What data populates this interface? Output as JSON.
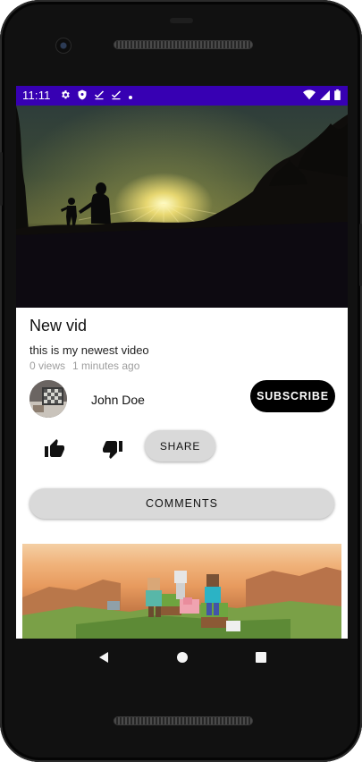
{
  "status_bar": {
    "time": "11:11",
    "left_icons": [
      "gear-icon",
      "shield-icon",
      "check-download-icon",
      "check-download-icon",
      "dot-icon"
    ],
    "right_icons": [
      "wifi-icon",
      "signal-icon",
      "battery-icon"
    ],
    "background_color": "#3700b3"
  },
  "video": {
    "title": "New vid",
    "description": "this is my newest video",
    "views": "0 views",
    "age": "1 minutes ago"
  },
  "channel": {
    "name": "John Doe",
    "subscribe_label": "SUBSCRIBE"
  },
  "actions": {
    "like_icon": "thumb-up-icon",
    "dislike_icon": "thumb-down-icon",
    "share_label": "SHARE",
    "comments_label": "COMMENTS"
  },
  "nav_bar": {
    "icons": [
      "back-icon",
      "home-icon",
      "recents-icon"
    ]
  }
}
